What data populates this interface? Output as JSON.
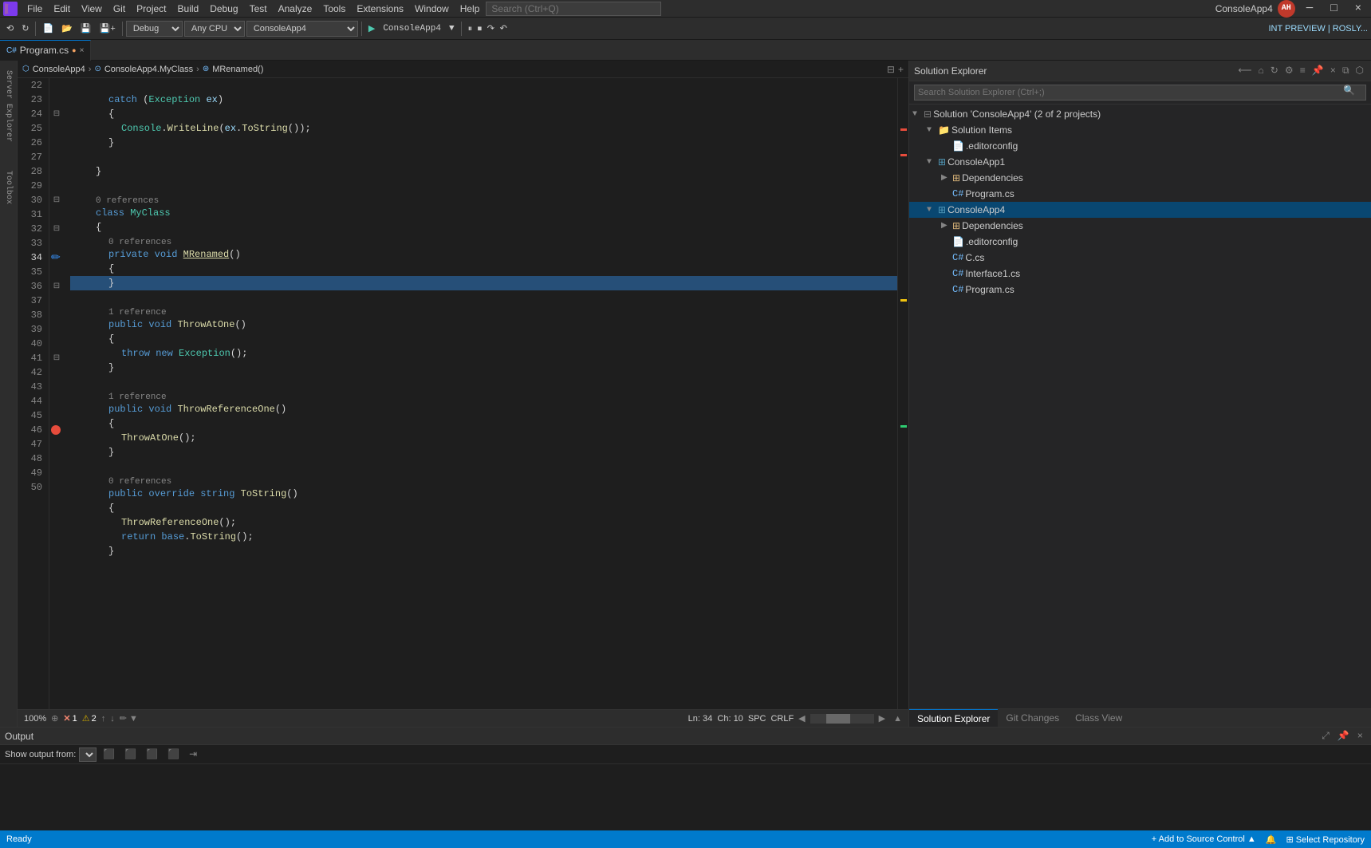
{
  "app": {
    "title": "ConsoleApp4",
    "logo_text": "VS",
    "window_controls": [
      "─",
      "□",
      "×"
    ]
  },
  "menu": {
    "items": [
      "File",
      "Edit",
      "View",
      "Git",
      "Project",
      "Build",
      "Debug",
      "Test",
      "Analyze",
      "Tools",
      "Extensions",
      "Window",
      "Help"
    ],
    "search_placeholder": "Search (Ctrl+Q)",
    "search_icon": "🔍"
  },
  "toolbar": {
    "debug_config": "Debug",
    "platform": "Any CPU",
    "project": "ConsoleApp4",
    "int_preview": "INT PREVIEW | ROSLY..."
  },
  "tab": {
    "filename": "Program.cs",
    "icon": "C#",
    "modified": true,
    "close": "×"
  },
  "breadcrumb": {
    "project": "ConsoleApp4",
    "class": "ConsoleApp4.MyClass",
    "method": "MRenamed()"
  },
  "code": {
    "lines": [
      {
        "num": 22,
        "indent": 3,
        "content": ""
      },
      {
        "num": 23,
        "indent": 3,
        "content": "catch (Exception ex)"
      },
      {
        "num": 24,
        "indent": 3,
        "content": "{"
      },
      {
        "num": 25,
        "indent": 4,
        "content": "Console.WriteLine(ex.ToString());"
      },
      {
        "num": 26,
        "indent": 3,
        "content": "}"
      },
      {
        "num": 27,
        "indent": 3,
        "content": ""
      },
      {
        "num": 28,
        "indent": 2,
        "content": "}"
      },
      {
        "num": 29,
        "indent": 0,
        "content": ""
      },
      {
        "num": 30,
        "indent": 2,
        "refs": "0 references",
        "content": "class MyClass"
      },
      {
        "num": 31,
        "indent": 2,
        "content": "{"
      },
      {
        "num": 32,
        "indent": 3,
        "refs": "0 references",
        "content": "private void MRenamed()"
      },
      {
        "num": 33,
        "indent": 3,
        "content": "{"
      },
      {
        "num": 34,
        "indent": 3,
        "content": "}",
        "selected": true
      },
      {
        "num": 35,
        "indent": 0,
        "content": ""
      },
      {
        "num": 36,
        "indent": 3,
        "refs": "1 reference",
        "content": "public void ThrowAtOne()"
      },
      {
        "num": 37,
        "indent": 3,
        "content": "{"
      },
      {
        "num": 38,
        "indent": 4,
        "content": "throw new Exception();"
      },
      {
        "num": 39,
        "indent": 3,
        "content": "}"
      },
      {
        "num": 40,
        "indent": 0,
        "content": ""
      },
      {
        "num": 41,
        "indent": 3,
        "refs": "1 reference",
        "content": "public void ThrowReferenceOne()"
      },
      {
        "num": 42,
        "indent": 3,
        "content": "{"
      },
      {
        "num": 43,
        "indent": 4,
        "content": "ThrowAtOne();"
      },
      {
        "num": 44,
        "indent": 3,
        "content": "}"
      },
      {
        "num": 45,
        "indent": 0,
        "content": ""
      },
      {
        "num": 46,
        "indent": 3,
        "refs": "0 references",
        "content": "public override string ToString()"
      },
      {
        "num": 47,
        "indent": 3,
        "content": "{"
      },
      {
        "num": 48,
        "indent": 4,
        "content": "ThrowReferenceOne();"
      },
      {
        "num": 49,
        "indent": 4,
        "content": "return base.ToString();"
      },
      {
        "num": 50,
        "indent": 3,
        "content": "}"
      }
    ]
  },
  "status": {
    "zoom": "100%",
    "line": "Ln: 34",
    "col": "Ch: 10",
    "encoding": "SPC",
    "line_ending": "CRLF",
    "error_count": "1",
    "warning_count": "2",
    "ready": "Ready"
  },
  "solution_explorer": {
    "title": "Solution Explorer",
    "search_placeholder": "Search Solution Explorer (Ctrl+;)",
    "solution_label": "Solution 'ConsoleApp4' (2 of 2 projects)",
    "tree": [
      {
        "id": "solution",
        "label": "Solution 'ConsoleApp4' (2 of 2 projects)",
        "icon": "solution",
        "indent": 0,
        "expanded": true
      },
      {
        "id": "solution-items",
        "label": "Solution Items",
        "icon": "folder",
        "indent": 1,
        "expanded": true
      },
      {
        "id": "editorconfig-1",
        "label": ".editorconfig",
        "icon": "config",
        "indent": 2,
        "expanded": false
      },
      {
        "id": "consoleapp1",
        "label": "ConsoleApp1",
        "icon": "project",
        "indent": 1,
        "expanded": true
      },
      {
        "id": "dependencies-1",
        "label": "Dependencies",
        "icon": "folder",
        "indent": 2,
        "expanded": false
      },
      {
        "id": "program-cs-1",
        "label": "Program.cs",
        "icon": "cs",
        "indent": 2,
        "expanded": false
      },
      {
        "id": "consoleapp4",
        "label": "ConsoleApp4",
        "icon": "project",
        "indent": 1,
        "expanded": true,
        "selected": true
      },
      {
        "id": "dependencies-4",
        "label": "Dependencies",
        "icon": "folder",
        "indent": 2,
        "expanded": false
      },
      {
        "id": "editorconfig-4",
        "label": ".editorconfig",
        "icon": "config",
        "indent": 2,
        "expanded": false
      },
      {
        "id": "c-cs",
        "label": "C.cs",
        "icon": "cs",
        "indent": 2,
        "expanded": false
      },
      {
        "id": "interface1-cs",
        "label": "Interface1.cs",
        "icon": "cs",
        "indent": 2,
        "expanded": false
      },
      {
        "id": "program-cs-4",
        "label": "Program.cs",
        "icon": "cs",
        "indent": 2,
        "expanded": false
      }
    ],
    "bottom_tabs": [
      "Solution Explorer",
      "Git Changes",
      "Class View"
    ],
    "active_tab": "Solution Explorer"
  },
  "output_panel": {
    "title": "Output",
    "filter_label": "Show output from:",
    "filter_placeholder": ""
  },
  "bottom_status": {
    "ready": "Ready",
    "add_to_source_control": "Add to Source Control",
    "select_repository": "Select Repository"
  }
}
